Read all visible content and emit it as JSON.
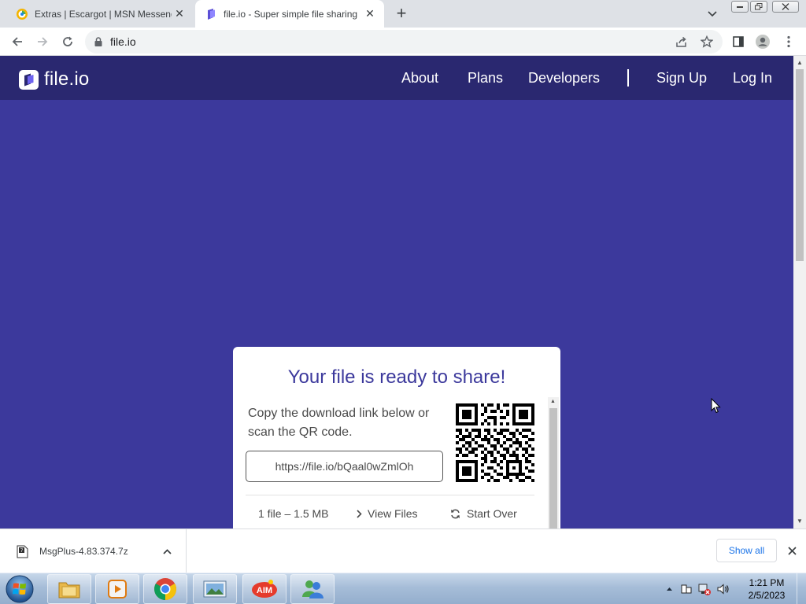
{
  "browser": {
    "tabs": [
      {
        "title": "Extras | Escargot | MSN Messenger",
        "active": false,
        "favicon": "escargot-icon"
      },
      {
        "title": "file.io - Super simple file sharing",
        "active": true,
        "favicon": "fileio-icon"
      }
    ],
    "url": "file.io"
  },
  "site": {
    "logo_text": "file.io",
    "nav": {
      "about": "About",
      "plans": "Plans",
      "developers": "Developers",
      "signup": "Sign Up",
      "login": "Log In"
    },
    "colors": {
      "header": "#2a2870",
      "background": "#3c399c"
    }
  },
  "card": {
    "title": "Your file is ready to share!",
    "description": "Copy the download link below or scan the QR code.",
    "link": "https://file.io/bQaal0wZmlOh",
    "file_info": "1 file – 1.5 MB",
    "view_files": "View Files",
    "start_over": "Start Over"
  },
  "downloads": {
    "item_name": "MsgPlus-4.83.374.7z",
    "show_all": "Show all"
  },
  "taskbar": {
    "apps": [
      "explorer-icon",
      "media-player-icon",
      "chrome-icon",
      "photo-viewer-icon",
      "aim-icon",
      "msn-messenger-icon"
    ],
    "time": "1:21 PM",
    "date": "2/5/2023"
  }
}
